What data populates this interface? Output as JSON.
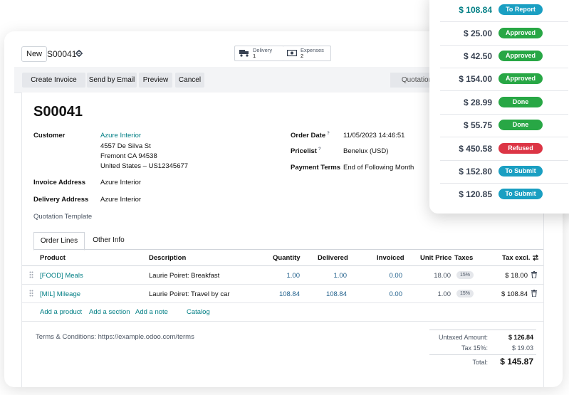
{
  "topbar": {
    "new_label": "New",
    "record_name": "S00041",
    "smart_buttons": [
      {
        "label": "Delivery",
        "value": "1",
        "icon": "truck-icon"
      },
      {
        "label": "Expenses",
        "value": "2",
        "icon": "money-icon"
      }
    ]
  },
  "actions": {
    "create_invoice": "Create Invoice",
    "send_email": "Send by Email",
    "preview": "Preview",
    "cancel": "Cancel",
    "status": "Quotation"
  },
  "form": {
    "title": "S00041",
    "customer_label": "Customer",
    "customer_name": "Azure Interior",
    "address_lines": [
      "4557 De Silva St",
      "Fremont CA 94538",
      "United States – US12345677"
    ],
    "invoice_address_label": "Invoice Address",
    "invoice_address": "Azure Interior",
    "delivery_address_label": "Delivery Address",
    "delivery_address": "Azure Interior",
    "quotation_template_label": "Quotation Template",
    "order_date_label": "Order Date",
    "order_date": "11/05/2023 14:46:51",
    "pricelist_label": "Pricelist",
    "pricelist": "Benelux (USD)",
    "payment_terms_label": "Payment Terms",
    "payment_terms": "End of Following Month",
    "help_mark": "?"
  },
  "tabs": [
    "Order Lines",
    "Other Info"
  ],
  "table": {
    "columns": [
      "Product",
      "Description",
      "Quantity",
      "Delivered",
      "Invoiced",
      "Unit Price",
      "Taxes",
      "Tax excl."
    ],
    "rows": [
      {
        "product": "[FOOD] Meals",
        "description": "Laurie Poiret: Breakfast",
        "quantity": "1.00",
        "delivered": "1.00",
        "invoiced": "0.00",
        "unit_price": "18.00",
        "taxes": "15%",
        "tax_excl": "$ 18.00"
      },
      {
        "product": "[MIL] Mileage",
        "description": "Laurie Poiret: Travel by car",
        "quantity": "108.84",
        "delivered": "108.84",
        "invoiced": "0.00",
        "unit_price": "1.00",
        "taxes": "15%",
        "tax_excl": "$ 108.84"
      }
    ],
    "add_links": [
      "Add a product",
      "Add a section",
      "Add a note",
      "Catalog"
    ]
  },
  "footer": {
    "terms": "Terms & Conditions: https://example.odoo.com/terms",
    "untaxed_label": "Untaxed Amount:",
    "untaxed_value": "$ 126.84",
    "tax_label": "Tax 15%:",
    "tax_value": "$ 19.03",
    "total_label": "Total:",
    "total_value": "$ 145.87"
  },
  "expenses_panel": [
    {
      "amount": "$ 108.84",
      "status": "To Report",
      "color": "#1a9fc2",
      "highlight": true
    },
    {
      "amount": "$ 25.00",
      "status": "Approved",
      "color": "#28a745"
    },
    {
      "amount": "$ 42.50",
      "status": "Approved",
      "color": "#28a745"
    },
    {
      "amount": "$ 154.00",
      "status": "Approved",
      "color": "#28a745"
    },
    {
      "amount": "$ 28.99",
      "status": "Done",
      "color": "#28a745"
    },
    {
      "amount": "$ 55.75",
      "status": "Done",
      "color": "#28a745"
    },
    {
      "amount": "$ 450.58",
      "status": "Refused",
      "color": "#dc3545"
    },
    {
      "amount": "$ 152.80",
      "status": "To Submit",
      "color": "#1a9fc2"
    },
    {
      "amount": "$ 120.85",
      "status": "To Submit",
      "color": "#1a9fc2"
    }
  ],
  "colors": {
    "accent": "#017e84",
    "link": "#017e84"
  }
}
